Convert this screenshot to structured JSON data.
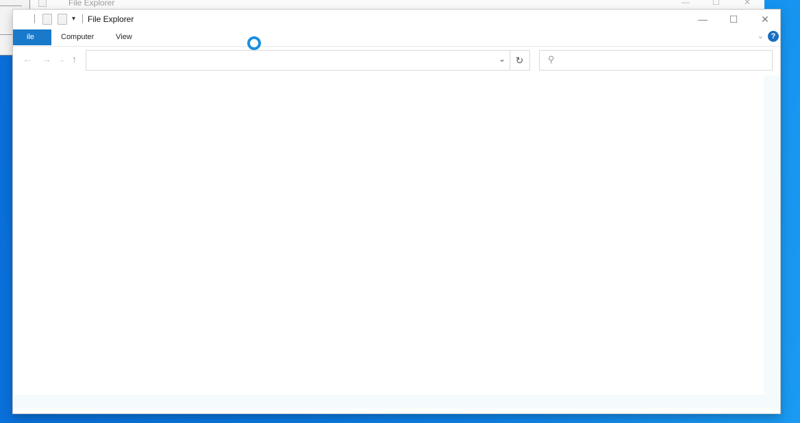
{
  "background_window": {
    "title": "File Explorer",
    "minimize_glyph": "—",
    "maximize_glyph": "☐",
    "close_glyph": "✕"
  },
  "window": {
    "title": "File Explorer",
    "qa_dropdown_glyph": "▾",
    "minimize_glyph": "—",
    "maximize_glyph": "☐",
    "close_glyph": "✕"
  },
  "ribbon": {
    "tabs": [
      {
        "label": "ile"
      },
      {
        "label": "Computer"
      },
      {
        "label": "View"
      }
    ],
    "collapse_glyph": "⌄",
    "help_glyph": "?"
  },
  "navigation": {
    "back_glyph": "←",
    "forward_glyph": "→",
    "recent_glyph": "⌄",
    "up_glyph": "↑"
  },
  "address_bar": {
    "value": "",
    "dropdown_glyph": "⌄",
    "refresh_glyph": "↻"
  },
  "search": {
    "value": "",
    "icon_glyph": "⚲"
  },
  "colors": {
    "accent": "#1979ca",
    "desktop": "#0a78e0",
    "busy_cursor": "#1c8fe0"
  }
}
